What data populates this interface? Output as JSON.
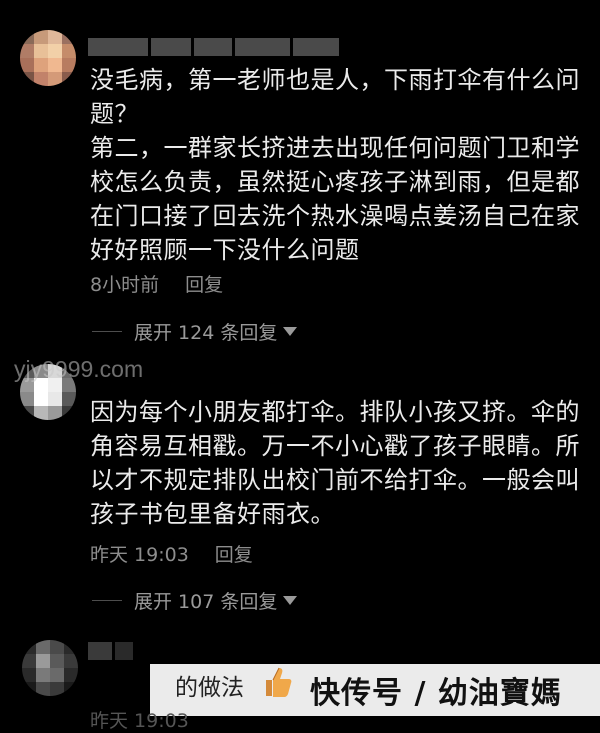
{
  "comments": [
    {
      "username_masked": "████ ███ ██",
      "text": "没毛病，第一老师也是人，下雨打伞有什么问\n题？\n第二，一群家长挤进去出现任何问题门卫和学\n校怎么负责，虽然挺心疼孩子淋到雨，但是都\n在门口接了回去洗个热水澡喝点姜汤自己在家\n好好照顾一下没什么问题",
      "time": "8小时前",
      "reply_label": "回复",
      "expand_label": "展开 124 条回复"
    },
    {
      "username_masked": "yjy9999.com",
      "text": "因为每个小朋友都打伞。排队小孩又挤。伞的\n角容易互相戳。万一不小心戳了孩子眼睛。所\n以才不规定排队出校门前不给打伞。一般会叫\n孩子书包里备好雨衣。",
      "time": "昨天 19:03",
      "reply_label": "回复",
      "expand_label": "展开 107 条回复"
    },
    {
      "partial_text": "的做法",
      "time_partial": "昨天 19:03"
    }
  ],
  "watermark": {
    "url": "yjy9999.com",
    "source": "快传号 / 幼油寶媽"
  },
  "colors": {
    "background": "#000000",
    "text": "#ebebeb",
    "meta": "#8d8d8d"
  }
}
